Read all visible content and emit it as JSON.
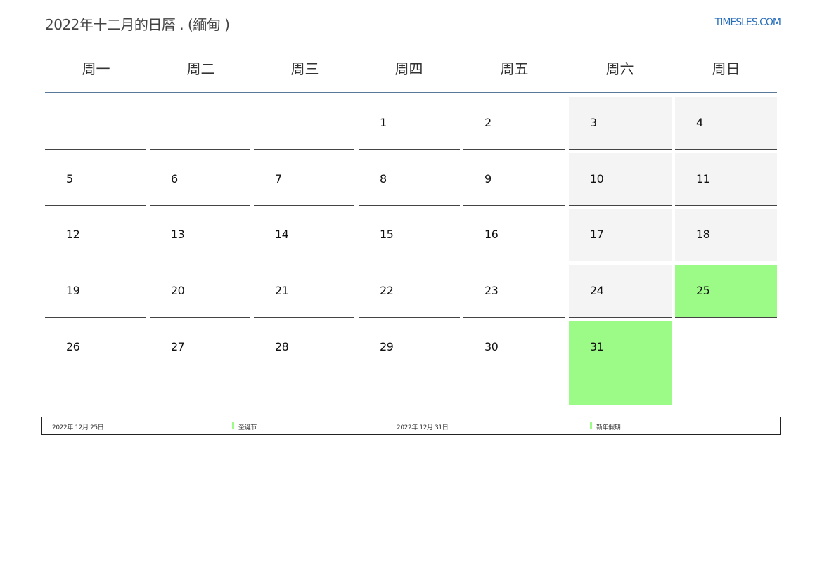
{
  "header": {
    "title": "2022年十二月的日曆 . (緬甸 )",
    "site": "TIMESLES.COM"
  },
  "weekdays": [
    "周一",
    "周二",
    "周三",
    "周四",
    "周五",
    "周六",
    "周日"
  ],
  "weeks": [
    [
      "",
      "",
      "",
      "1",
      "2",
      "3",
      "4"
    ],
    [
      "5",
      "6",
      "7",
      "8",
      "9",
      "10",
      "11"
    ],
    [
      "12",
      "13",
      "14",
      "15",
      "16",
      "17",
      "18"
    ],
    [
      "19",
      "20",
      "21",
      "22",
      "23",
      "24",
      "25"
    ],
    [
      "26",
      "27",
      "28",
      "29",
      "30",
      "31",
      ""
    ]
  ],
  "holidays": [
    {
      "date": "2022年 12月 25日",
      "name": "圣诞节",
      "day": "25"
    },
    {
      "date": "2022年 12月 31日",
      "name": "新年假期",
      "day": "31"
    }
  ],
  "colors": {
    "holiday": "#9cfb86",
    "weekend": "#f4f4f4",
    "header_line": "#5a7899",
    "link": "#2a6ebb"
  }
}
